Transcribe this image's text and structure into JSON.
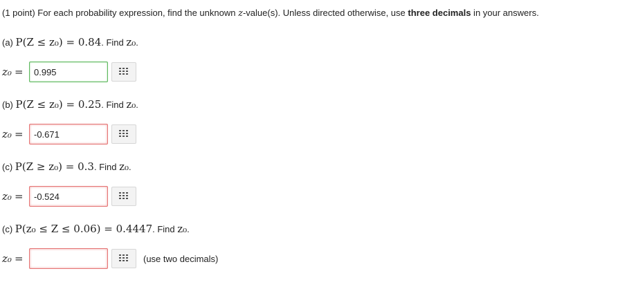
{
  "intro": {
    "prefix": "(1 point) For each probability expression, find the unknown ",
    "var": "z",
    "middle": "-value(s). Unless directed otherwise, use ",
    "bold": "three decimals",
    "suffix": " in your answers."
  },
  "questions": [
    {
      "label": "(a) ",
      "expr": "P(Z ≤ z₀) = 0.84",
      "find": ". Find ",
      "find_var": "z₀",
      "end": ".",
      "answer_label": "z₀",
      "equals": "=",
      "value": "0.995",
      "state": "correct"
    },
    {
      "label": "(b) ",
      "expr": "P(Z ≤ z₀) = 0.25",
      "find": ". Find ",
      "find_var": "z₀",
      "end": ".",
      "answer_label": "z₀",
      "equals": "=",
      "value": "-0.671",
      "state": "incorrect"
    },
    {
      "label": "(c) ",
      "expr": "P(Z ≥ z₀) = 0.3",
      "find": ". Find ",
      "find_var": "z₀",
      "end": ".",
      "answer_label": "z₀",
      "equals": "=",
      "value": "-0.524",
      "state": "incorrect"
    },
    {
      "label": "(c) ",
      "expr": "P(z₀ ≤ Z ≤ 0.06) = 0.4447",
      "find": ". Find ",
      "find_var": "z₀",
      "end": ".",
      "answer_label": "z₀",
      "equals": "=",
      "value": "",
      "state": "incorrect",
      "hint": "(use two decimals)"
    }
  ],
  "icons": {
    "palette": "equation-palette-icon"
  },
  "colors": {
    "correct_border": "#5cb85c",
    "incorrect_border": "#e57373"
  }
}
